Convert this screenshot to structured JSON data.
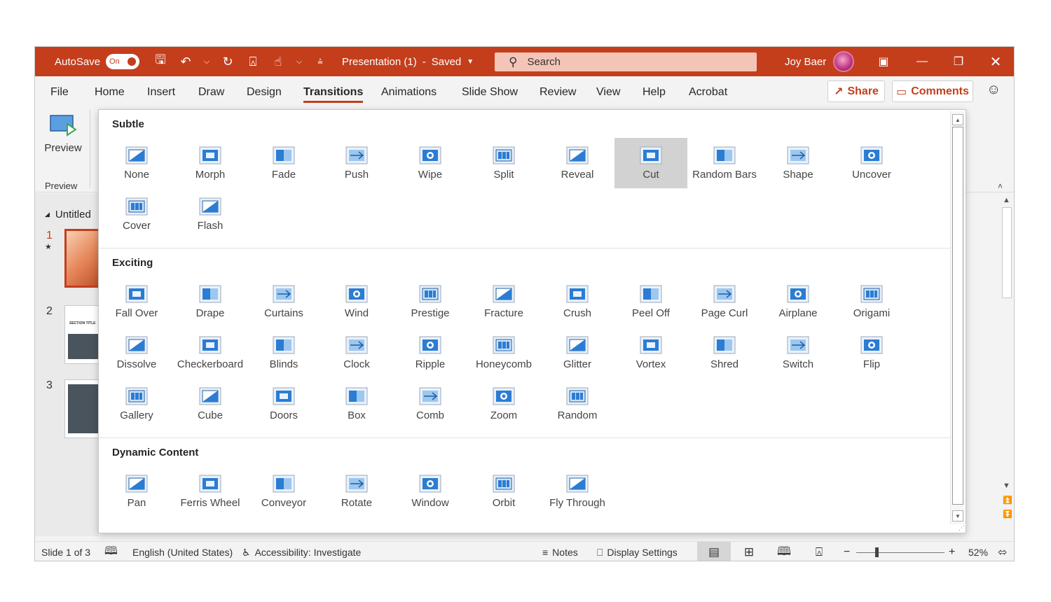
{
  "titlebar": {
    "autosave_label": "AutoSave",
    "autosave_state": "On",
    "document_title": "Presentation (1)",
    "separator": "-",
    "save_state": "Saved",
    "search_placeholder": "Search",
    "user_name": "Joy Baer",
    "icons": [
      "save-icon",
      "undo-icon",
      "redo-icon",
      "present-icon",
      "touch-mode-icon",
      "customize-icon"
    ]
  },
  "menu": {
    "tabs": [
      "File",
      "Home",
      "Insert",
      "Draw",
      "Design",
      "Transitions",
      "Animations",
      "Slide Show",
      "Review",
      "View",
      "Help",
      "Acrobat"
    ],
    "active": "Transitions",
    "share": "Share",
    "comments": "Comments"
  },
  "ribbon": {
    "preview_button": "Preview",
    "preview_group": "Preview"
  },
  "slides_pane": {
    "section": "Untitled",
    "slides": [
      "1",
      "2",
      "3"
    ],
    "thumb2_text": "SECTION TITLE"
  },
  "gallery": {
    "sections": [
      {
        "title": "Subtle",
        "items": [
          "None",
          "Morph",
          "Fade",
          "Push",
          "Wipe",
          "Split",
          "Reveal",
          "Cut",
          "Random Bars",
          "Shape",
          "Uncover",
          "Cover",
          "Flash"
        ]
      },
      {
        "title": "Exciting",
        "items": [
          "Fall Over",
          "Drape",
          "Curtains",
          "Wind",
          "Prestige",
          "Fracture",
          "Crush",
          "Peel Off",
          "Page Curl",
          "Airplane",
          "Origami",
          "Dissolve",
          "Checkerboard",
          "Blinds",
          "Clock",
          "Ripple",
          "Honeycomb",
          "Glitter",
          "Vortex",
          "Shred",
          "Switch",
          "Flip",
          "Gallery",
          "Cube",
          "Doors",
          "Box",
          "Comb",
          "Zoom",
          "Random"
        ]
      },
      {
        "title": "Dynamic Content",
        "items": [
          "Pan",
          "Ferris Wheel",
          "Conveyor",
          "Rotate",
          "Window",
          "Orbit",
          "Fly Through"
        ]
      }
    ],
    "selected": "Cut"
  },
  "statusbar": {
    "slide_info": "Slide 1 of 3",
    "language": "English (United States)",
    "accessibility": "Accessibility: Investigate",
    "notes": "Notes",
    "display_settings": "Display Settings",
    "zoom_minus": "−",
    "zoom_plus": "+",
    "zoom": "52%"
  },
  "colors": {
    "accent": "#c43e1c",
    "icon_blue": "#2b7cd3"
  }
}
